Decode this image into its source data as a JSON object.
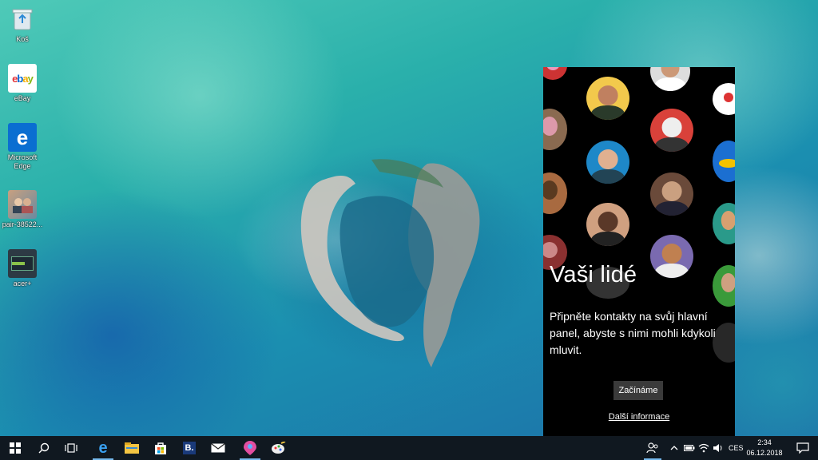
{
  "desktop": {
    "icons": [
      {
        "label": "Koš",
        "icon": "recycle-bin-icon"
      },
      {
        "label": "eBay",
        "icon": "ebay-icon"
      },
      {
        "label": "Microsoft Edge",
        "icon": "edge-icon"
      },
      {
        "label": "pair-38522...",
        "icon": "image-file-icon"
      },
      {
        "label": "acer+",
        "icon": "acer-icon"
      }
    ]
  },
  "people_panel": {
    "title": "Vaši lidé",
    "description": "Připněte kontakty na svůj hlavní panel, abyste s nimi mohli kdykoli mluvit.",
    "start_button": "Začínáme",
    "more_info_link": "Další informace"
  },
  "taskbar": {
    "apps": [
      "start-icon",
      "search-icon",
      "task-view-icon",
      "edge-icon",
      "file-explorer-icon",
      "store-icon",
      "booking-icon",
      "mail-icon",
      "maps-icon",
      "paint-icon"
    ],
    "language": "CES",
    "time": "2:34",
    "date": "06.12.2018"
  },
  "colors": {
    "taskbar": "#101820",
    "accent": "#76b9ed",
    "panel_bg": "#000000"
  }
}
